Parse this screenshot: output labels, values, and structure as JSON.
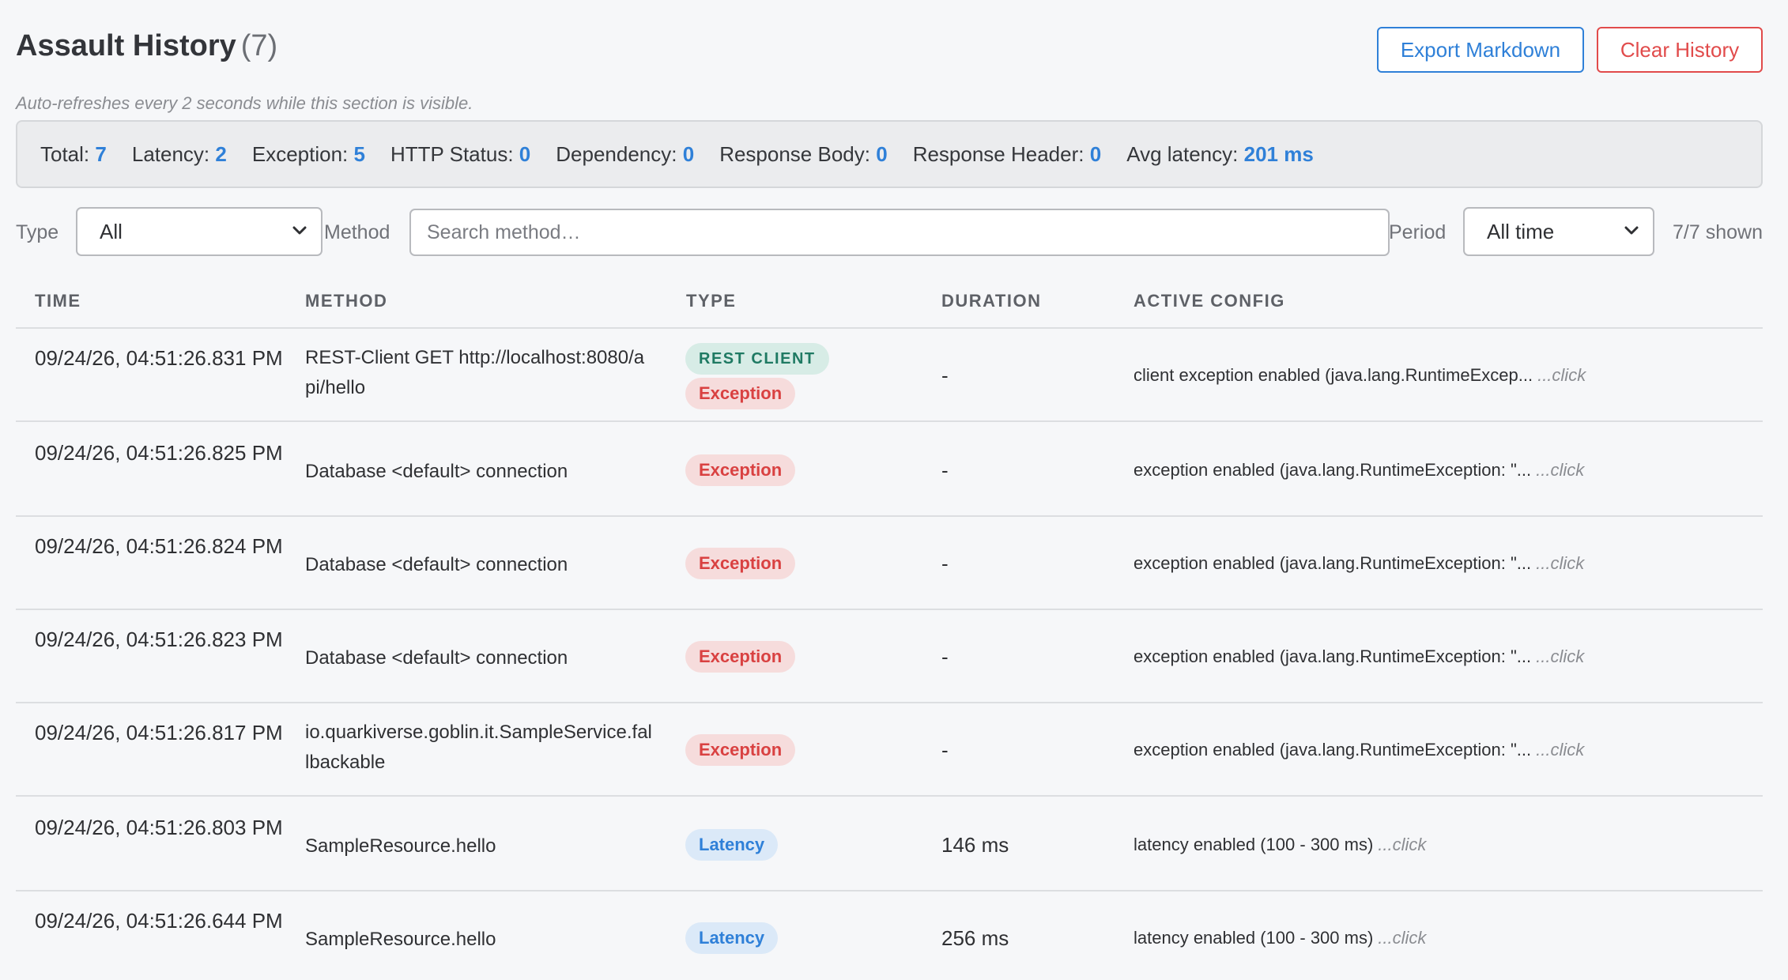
{
  "header": {
    "title": "Assault History",
    "count": "(7)",
    "export_label": "Export Markdown",
    "clear_label": "Clear History",
    "hint": "Auto-refreshes every 2 seconds while this section is visible."
  },
  "stats": [
    {
      "label": "Total:",
      "value": "7"
    },
    {
      "label": "Latency:",
      "value": "2"
    },
    {
      "label": "Exception:",
      "value": "5"
    },
    {
      "label": "HTTP Status:",
      "value": "0"
    },
    {
      "label": "Dependency:",
      "value": "0"
    },
    {
      "label": "Response Body:",
      "value": "0"
    },
    {
      "label": "Response Header:",
      "value": "0"
    },
    {
      "label": "Avg latency:",
      "value": "201 ms"
    }
  ],
  "filters": {
    "type_label": "Type",
    "type_value": "All",
    "method_label": "Method",
    "method_placeholder": "Search method…",
    "period_label": "Period",
    "period_value": "All time",
    "shown": "7/7 shown"
  },
  "table": {
    "headers": [
      "TIME",
      "METHOD",
      "TYPE",
      "DURATION",
      "ACTIVE CONFIG"
    ],
    "click_label": "...click",
    "rows": [
      {
        "time": "09/24/26, 04:51:26.831 PM",
        "method": "REST-Client GET http://localhost:8080/api/hello",
        "badges": [
          {
            "text": "REST CLIENT",
            "kind": "rest"
          },
          {
            "text": "Exception",
            "kind": "exc"
          }
        ],
        "duration": "-",
        "config": "client exception enabled (java.lang.RuntimeExcep..."
      },
      {
        "time": "09/24/26, 04:51:26.825 PM",
        "method": "Database <default> connection",
        "badges": [
          {
            "text": "Exception",
            "kind": "exc"
          }
        ],
        "duration": "-",
        "config": "exception enabled (java.lang.RuntimeException: \"..."
      },
      {
        "time": "09/24/26, 04:51:26.824 PM",
        "method": "Database <default> connection",
        "badges": [
          {
            "text": "Exception",
            "kind": "exc"
          }
        ],
        "duration": "-",
        "config": "exception enabled (java.lang.RuntimeException: \"..."
      },
      {
        "time": "09/24/26, 04:51:26.823 PM",
        "method": "Database <default> connection",
        "badges": [
          {
            "text": "Exception",
            "kind": "exc"
          }
        ],
        "duration": "-",
        "config": "exception enabled (java.lang.RuntimeException: \"..."
      },
      {
        "time": "09/24/26, 04:51:26.817 PM",
        "method": "io.quarkiverse.goblin.it.SampleService.fallbackable",
        "badges": [
          {
            "text": "Exception",
            "kind": "exc"
          }
        ],
        "duration": "-",
        "config": "exception enabled (java.lang.RuntimeException: \"..."
      },
      {
        "time": "09/24/26, 04:51:26.803 PM",
        "method": "SampleResource.hello",
        "badges": [
          {
            "text": "Latency",
            "kind": "lat"
          }
        ],
        "duration": "146 ms",
        "config": "latency enabled (100 - 300 ms)"
      },
      {
        "time": "09/24/26, 04:51:26.644 PM",
        "method": "SampleResource.hello",
        "badges": [
          {
            "text": "Latency",
            "kind": "lat"
          }
        ],
        "duration": "256 ms",
        "config": "latency enabled (100 - 300 ms)"
      }
    ]
  }
}
